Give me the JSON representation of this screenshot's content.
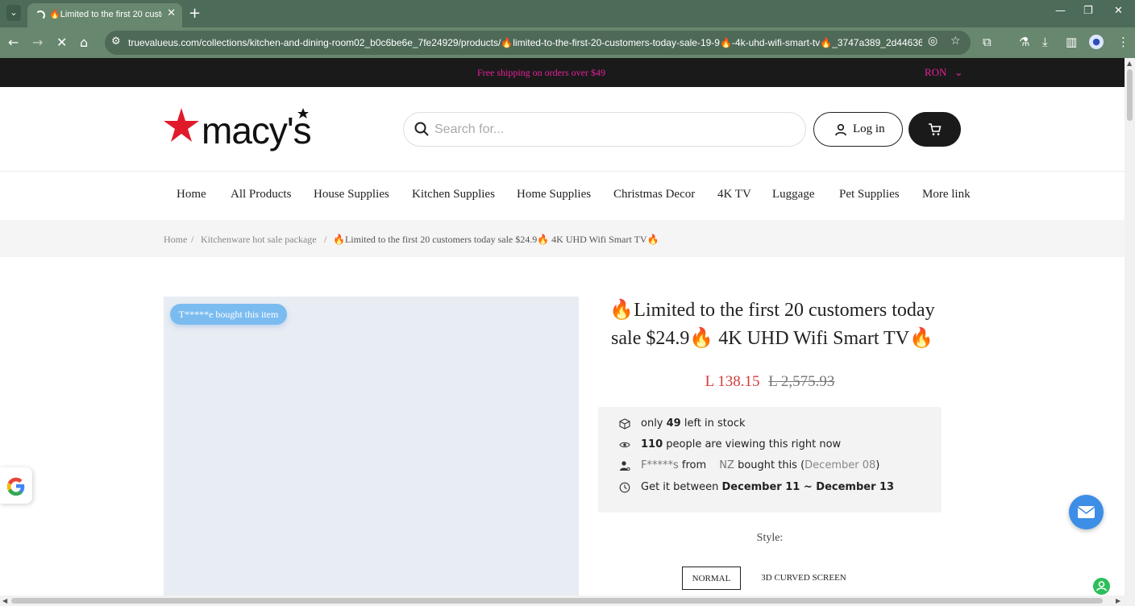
{
  "browser": {
    "tab_title": "🔥Limited to the first 20 customers today sale $24.9🔥 4K UHD Wifi Smart TV🔥",
    "tab_close": "✕",
    "new_tab": "+",
    "url": "truevalueus.com/collections/kitchen-and-dining-room02_b0c6be6e_7fe24929/products/🔥limited-to-the-first-20-customers-today-sale-19-9🔥-4k-uhd-wifi-smart-tv🔥_3747a389_2d44636a_...",
    "icons": [
      "tab-list-icon",
      "back-icon",
      "forward-icon",
      "stop-icon",
      "home-icon",
      "site-info-icon",
      "eye-off-icon",
      "star-icon",
      "extensions-icon",
      "labs-icon",
      "download-icon",
      "sidebar-icon",
      "profile-icon",
      "menu-icon"
    ]
  },
  "announcement": {
    "text": "Free shipping on orders over $49",
    "currency": "RON"
  },
  "brand": {
    "name": "macy's",
    "star_color": "#e11a2b"
  },
  "search": {
    "placeholder": "Search for..."
  },
  "header": {
    "login_label": "Log in"
  },
  "nav": {
    "items": [
      "Home",
      "All Products",
      "House Supplies",
      "Kitchen Supplies",
      "Home Supplies",
      "Christmas Decor",
      "4K TV",
      "Luggage",
      "Pet Supplies",
      "More link"
    ]
  },
  "breadcrumb": {
    "home": "Home",
    "separator": "/",
    "collection": "Kitchenware hot sale package",
    "current": "🔥Limited to the first 20 customers today sale $24.9🔥 4K UHD Wifi Smart TV🔥"
  },
  "gallery": {
    "bought_badge": "T*****e bought this item"
  },
  "product": {
    "title": "🔥Limited to the first 20 customers today sale $24.9🔥 4K UHD Wifi Smart TV🔥",
    "price": "L 138.15",
    "compare_price": "L 2,575.93",
    "price_color": "#d43b3b"
  },
  "info": {
    "stock_pre": "only ",
    "stock_count": "49",
    "stock_post": " left in stock",
    "viewers_count": "110",
    "viewers_post": " people are viewing this right now",
    "buyer_name": "F*****s",
    "buyer_from": " from ",
    "buyer_country": "NZ",
    "buyer_post": " bought this (",
    "buyer_date": "December 08",
    "buyer_close": ")",
    "delivery_pre": "Get it between ",
    "delivery_range": "December 11 ~ December 13"
  },
  "style": {
    "label": "Style:",
    "options": [
      "NORMAL",
      "3D CURVED SCREEN"
    ],
    "selected": "NORMAL"
  },
  "colors": {
    "announce_bg": "#1a1a1a",
    "announce_text": "#e5219a",
    "chrome_bg": "#68876f",
    "badge_bg": "#7bbcf0",
    "mail_btn": "#3d8ee6"
  }
}
